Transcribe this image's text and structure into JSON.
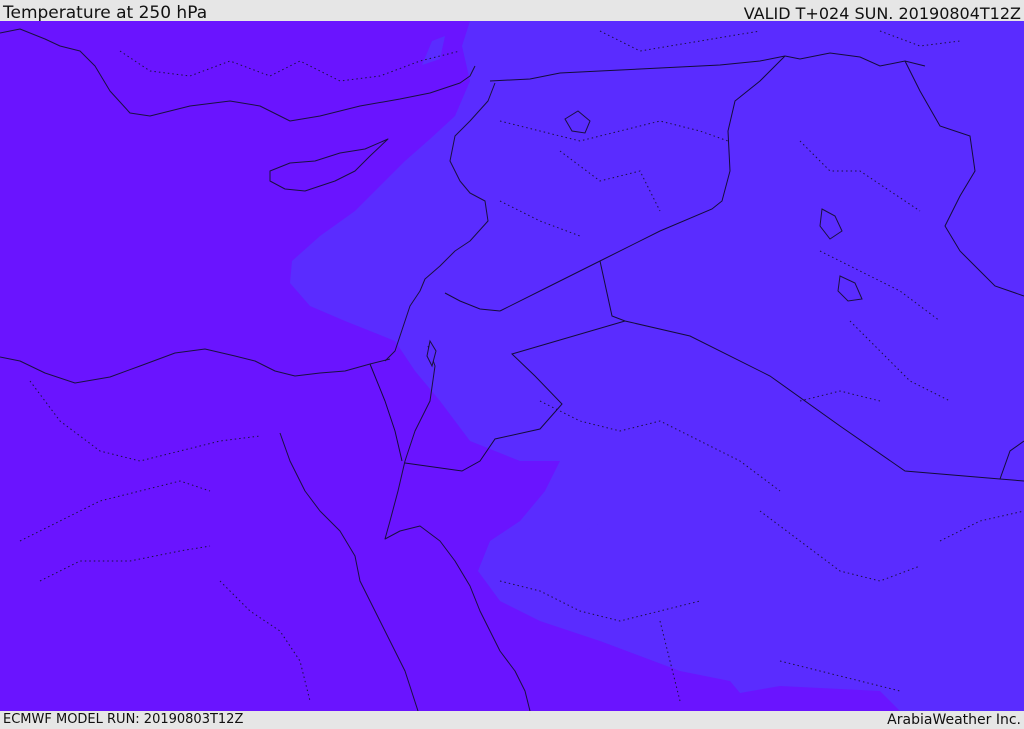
{
  "header": {
    "title": "Temperature at 250 hPa",
    "valid": "VALID T+024 SUN. 20190804T12Z"
  },
  "footer": {
    "model_run": "ECMWF MODEL RUN: 20190803T12Z",
    "credit": "ArabiaWeather Inc."
  },
  "colors": {
    "field_band_a": "#6a14ff",
    "field_band_b": "#5a2cff",
    "coastline": "#1a1040",
    "background": "#e6e6e6"
  }
}
